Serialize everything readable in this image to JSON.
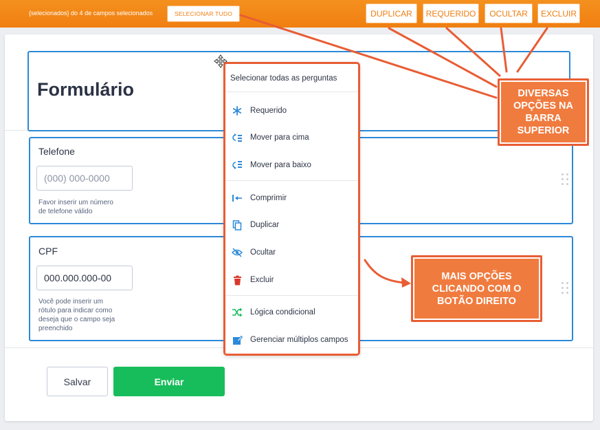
{
  "topbar": {
    "selected_text": "{selecionados} do 4 de campos selecionados",
    "select_all_label": "SELECIONAR TUDO",
    "duplicate_label": "DUPLICAR",
    "required_label": "REQUERIDO",
    "hide_label": "OCULTAR",
    "delete_label": "EXCLUIR"
  },
  "form": {
    "title": "Formulário",
    "fields": [
      {
        "label": "Telefone",
        "placeholder": "(000) 000-0000",
        "hint_lines": [
          "Favor inserir um número",
          "de telefone válido"
        ]
      },
      {
        "label": "CPF",
        "value": "000.000.000-00",
        "hint_lines": [
          "Você pode inserir um",
          "rótulo para indicar como",
          "deseja que o campo seja",
          "preenchido"
        ]
      }
    ],
    "save_label": "Salvar",
    "send_label": "Enviar"
  },
  "context_menu": {
    "header": "Selecionar todas as perguntas",
    "items": [
      {
        "label": "Requerido",
        "icon": "asterisk-icon"
      },
      {
        "label": "Mover para cima",
        "icon": "move-up-icon"
      },
      {
        "label": "Mover para baixo",
        "icon": "move-down-icon"
      },
      {
        "label": "Comprimir",
        "icon": "shrink-icon"
      },
      {
        "label": "Duplicar",
        "icon": "duplicate-icon"
      },
      {
        "label": "Ocultar",
        "icon": "eye-off-icon"
      },
      {
        "label": "Excluir",
        "icon": "trash-icon"
      },
      {
        "label": "Lógica condicional",
        "icon": "shuffle-icon"
      },
      {
        "label": "Gerenciar múltiplos campos",
        "icon": "edit-icon"
      }
    ]
  },
  "annotations": {
    "top": "DIVERSAS OPÇÕES NA BARRA SUPERIOR",
    "right_click": "MAIS OPÇÕES CLICANDO COM O BOTÃO DIREITO"
  },
  "colors": {
    "topbar": "#f07f10",
    "field_border": "#2c89d9",
    "annotation": "#e85d34",
    "send_button": "#18bd5b",
    "icon_blue": "#2c89d9",
    "icon_red": "#d9382a",
    "icon_green": "#18bd5b"
  }
}
